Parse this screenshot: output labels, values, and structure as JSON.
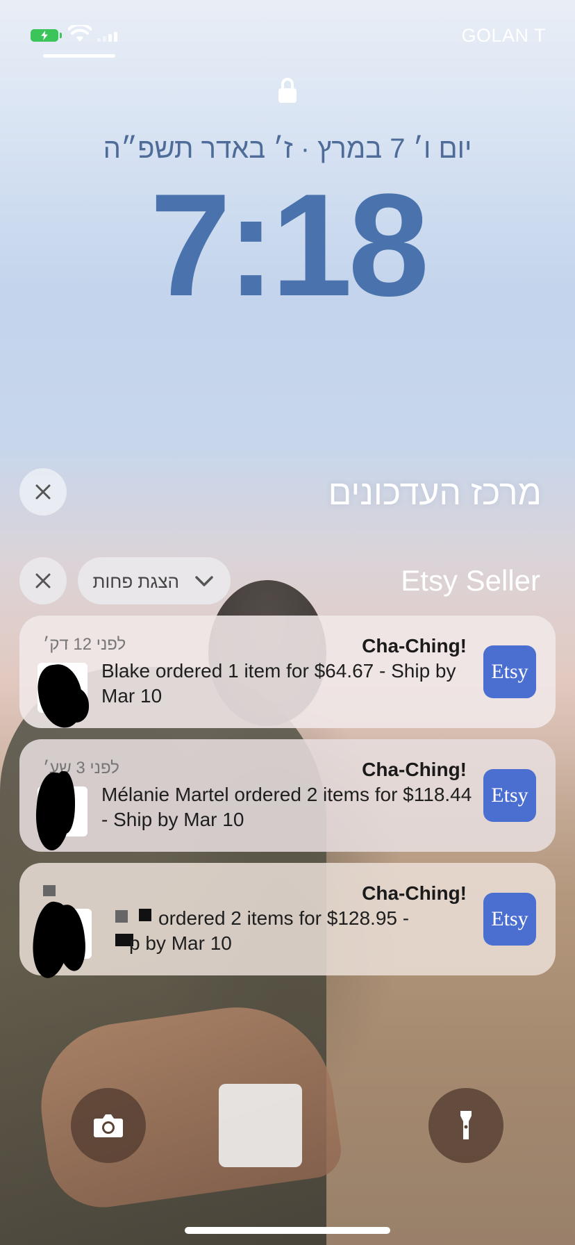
{
  "status_bar": {
    "carrier": "GOLAN T",
    "battery_color": "#3bc45a"
  },
  "lock_screen": {
    "date": "יום ו׳ 7 במרץ · ז׳ באדר תשפ״ה",
    "time": "7:18"
  },
  "notification_center": {
    "title": "מרכז העדכונים"
  },
  "group": {
    "app_name": "Etsy Seller",
    "show_less_label": "הצגת פחות"
  },
  "notifications": [
    {
      "app_icon_text": "Etsy",
      "title": "Cha-Ching!",
      "time": "לפני 12 דק׳",
      "body": "Blake ordered 1 item for $64.67 - Ship by Mar 10"
    },
    {
      "app_icon_text": "Etsy",
      "title": "Cha-Ching!",
      "time": "לפני 3 שע׳",
      "body": "Mélanie Martel ordered 2 items for $118.44 - Ship by Mar 10"
    },
    {
      "app_icon_text": "Etsy",
      "title": "Cha-Ching!",
      "time": "",
      "body_part1": "ordered 2 items for $128.95 -",
      "body_part2": "p by Mar 10"
    }
  ],
  "controls": {
    "camera_icon": "camera-icon",
    "flashlight_icon": "flashlight-icon"
  },
  "colors": {
    "time_color": "#4a72ad",
    "etsy_icon": "#4b6fd0"
  }
}
